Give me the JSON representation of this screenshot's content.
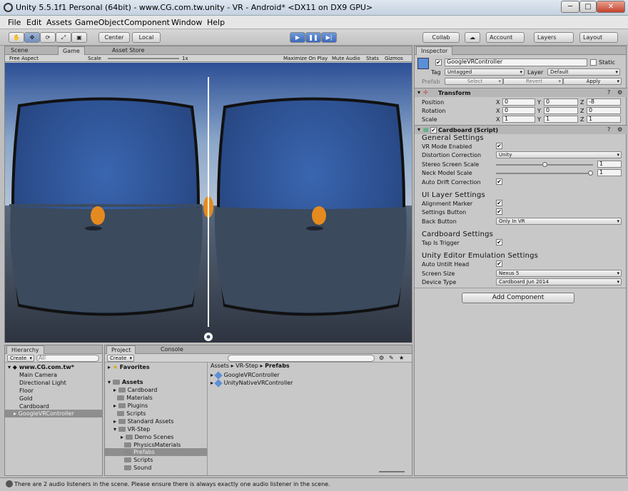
{
  "window": {
    "title": "Unity 5.5.1f1 Personal (64bit) - www.CG.com.tw.unity - VR - Android* <DX11 on DX9 GPU>",
    "min": "─",
    "max": "□",
    "close": "✕"
  },
  "menu": [
    "File",
    "Edit",
    "Assets",
    "GameObject",
    "Component",
    "Window",
    "Help"
  ],
  "toolbar": {
    "center": "Center",
    "local": "Local",
    "collab": "Collab",
    "account": "Account",
    "layers": "Layers",
    "layout": "Layout",
    "play": "▶",
    "pause": "❚❚",
    "step": "▶|"
  },
  "game_tabs": {
    "scene": "Scene",
    "game": "Game",
    "asset_store": "Asset Store"
  },
  "game_bar": {
    "aspect": "Free Aspect",
    "scale_label": "Scale",
    "scale_value": "1x",
    "maximize": "Maximize On Play",
    "mute": "Mute Audio",
    "stats": "Stats",
    "gizmos": "Gizmos"
  },
  "hierarchy": {
    "tab": "Hierarchy",
    "create": "Create",
    "search": "All",
    "scene": "www.CG.com.tw*",
    "items": [
      "Main Camera",
      "Directional Light",
      "Floor",
      "Gold",
      "Cardboard",
      "GoogleVRController"
    ]
  },
  "project": {
    "tab": "Project",
    "console_tab": "Console",
    "create": "Create",
    "favorites": "Favorites",
    "assets": "Assets",
    "folders": [
      "Cardboard",
      "Materials",
      "Plugins",
      "Scripts",
      "Standard Assets",
      "VR-Step"
    ],
    "vr_step_children": [
      "Demo Scenes",
      "PhysicsMaterials",
      "Prefabs",
      "Scripts",
      "Sound"
    ],
    "breadcrumb": [
      "Assets",
      "VR-Step",
      "Prefabs"
    ],
    "files": [
      "GoogleVRController",
      "UnityNativeVRController"
    ]
  },
  "inspector": {
    "tab": "Inspector",
    "object_name": "GoogleVRController",
    "static": "Static",
    "tag_label": "Tag",
    "tag": "Untagged",
    "layer_label": "Layer",
    "layer": "Default",
    "prefab_label": "Prefab",
    "select": "Select",
    "revert": "Revert",
    "apply": "Apply",
    "transform": {
      "title": "Transform",
      "position": "Position",
      "rotation": "Rotation",
      "scale": "Scale",
      "pos": [
        "0",
        "0",
        "-8"
      ],
      "rot": [
        "0",
        "0",
        "0"
      ],
      "scl": [
        "1",
        "1",
        "1"
      ]
    },
    "cardboard": {
      "title": "Cardboard (Script)",
      "general": "General Settings",
      "vr_mode": "VR Mode Enabled",
      "distortion": "Distortion Correction",
      "distortion_value": "Unity",
      "stereo": "Stereo Screen Scale",
      "stereo_value": "1",
      "stereo_level": 0.5,
      "neck": "Neck Model Scale",
      "neck_value": "1",
      "neck_level": 1.0,
      "auto_drift": "Auto Drift Correction",
      "ui": "UI Layer Settings",
      "alignment": "Alignment Marker",
      "settings_button": "Settings Button",
      "back_button": "Back Button",
      "back_value": "Only In VR",
      "cb_settings": "Cardboard Settings",
      "tap": "Tap Is Trigger",
      "emulation": "Unity Editor Emulation Settings",
      "auto_untilt": "Auto Untilt Head",
      "screen_size": "Screen Size",
      "screen_value": "Nexus 5",
      "device": "Device Type",
      "device_value": "Cardboard Jun 2014"
    },
    "add_component": "Add Component"
  },
  "status": "There are 2 audio listeners in the scene. Please ensure there is always exactly one audio listener in the scene.",
  "colors": {
    "accent": "#3d6fc4",
    "selection": "#8e8e8e",
    "sky": "#4a6ba8"
  }
}
